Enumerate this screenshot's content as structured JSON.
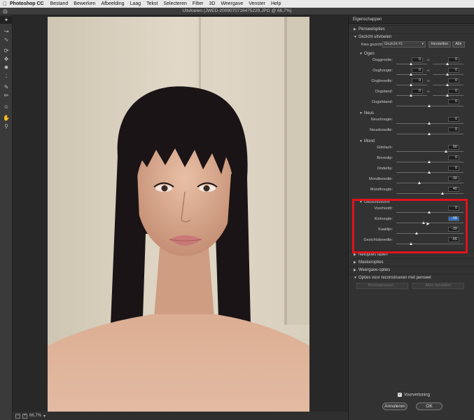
{
  "menubar": {
    "app": "Photoshop CC",
    "items": [
      "Bestand",
      "Bewerken",
      "Afbeelding",
      "Laag",
      "Tekst",
      "Selecteren",
      "Filter",
      "3D",
      "Weergave",
      "Venster",
      "Help"
    ]
  },
  "window": {
    "title": "Uitvloeien (JWED-2009070716475229.JPG @ 66,7%)"
  },
  "status": {
    "zoom": "66,7%"
  },
  "panel": {
    "header": "Eigenschappen",
    "sections": {
      "penseel": "Penseelopties",
      "gezicht": "Gezicht uitvloeien",
      "selectie": "Netopties laden",
      "masker": "Maskeropties",
      "weergave": "Weergave-opties",
      "reconstrueer": "Opties voor reconstrueren met penseel"
    },
    "chooser": {
      "label": "Kies gezicht:",
      "value": "Gezicht #1",
      "herstellen": "Herstellen",
      "alle": "Alle"
    },
    "ogen": {
      "title": "Ogen",
      "rows": [
        {
          "label": "Ooggrootte:",
          "left": "0",
          "right": "0"
        },
        {
          "label": "Ooghoogte:",
          "left": "0",
          "right": "0"
        },
        {
          "label": "Oogbreedte:",
          "left": "0",
          "right": "0"
        },
        {
          "label": "Oogstand:",
          "left": "0",
          "right": "0"
        },
        {
          "label": "Oogafstand:",
          "value": "0"
        }
      ]
    },
    "neus": {
      "title": "Neus",
      "rows": [
        {
          "label": "Neushoogte:",
          "value": "0"
        },
        {
          "label": "Neusbreedte:",
          "value": "0"
        }
      ]
    },
    "mond": {
      "title": "Mond",
      "rows": [
        {
          "label": "Glimlach:",
          "value": "50"
        },
        {
          "label": "Bovenlip:",
          "value": "0"
        },
        {
          "label": "Onderlip:",
          "value": "0"
        },
        {
          "label": "Mondbreedte:",
          "value": "-30"
        },
        {
          "label": "Mondhoogte:",
          "value": "40"
        }
      ]
    },
    "gezichtsvorm": {
      "title": "Gezichtsvorm",
      "rows": [
        {
          "label": "Voorhoofd:",
          "value": "0"
        },
        {
          "label": "Kinhoogte:",
          "value": "-16"
        },
        {
          "label": "Kaaklijn:",
          "value": "-39"
        },
        {
          "label": "Gezichtsbreedte:",
          "value": "-55"
        }
      ]
    },
    "reconstruct_btn": "Reconstrueren...",
    "restore_all_btn": "Alles herstellen",
    "preview_label": "Voorvertoning",
    "cancel": "Annuleren",
    "ok": "OK"
  }
}
